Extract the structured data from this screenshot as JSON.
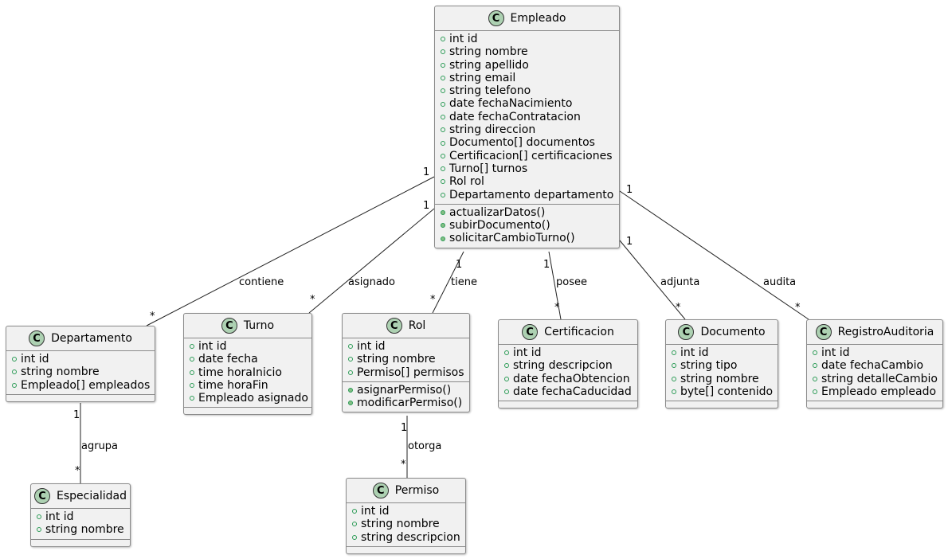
{
  "diagram": {
    "type": "UML class diagram",
    "classes": {
      "empleado": {
        "name": "Empleado",
        "stereotype_icon": "C",
        "attributes": [
          "int id",
          "string nombre",
          "string apellido",
          "string email",
          "string telefono",
          "date fechaNacimiento",
          "date fechaContratacion",
          "string direccion",
          "Documento[] documentos",
          "Certificacion[] certificaciones",
          "Turno[] turnos",
          "Rol rol",
          "Departamento departamento"
        ],
        "methods": [
          "actualizarDatos()",
          "subirDocumento()",
          "solicitarCambioTurno()"
        ]
      },
      "departamento": {
        "name": "Departamento",
        "stereotype_icon": "C",
        "attributes": [
          "int id",
          "string nombre",
          "Empleado[] empleados"
        ],
        "methods": []
      },
      "turno": {
        "name": "Turno",
        "stereotype_icon": "C",
        "attributes": [
          "int id",
          "date fecha",
          "time horaInicio",
          "time horaFin",
          "Empleado asignado"
        ],
        "methods": []
      },
      "rol": {
        "name": "Rol",
        "stereotype_icon": "C",
        "attributes": [
          "int id",
          "string nombre",
          "Permiso[] permisos"
        ],
        "methods": [
          "asignarPermiso()",
          "modificarPermiso()"
        ]
      },
      "certificacion": {
        "name": "Certificacion",
        "stereotype_icon": "C",
        "attributes": [
          "int id",
          "string descripcion",
          "date fechaObtencion",
          "date fechaCaducidad"
        ],
        "methods": []
      },
      "documento": {
        "name": "Documento",
        "stereotype_icon": "C",
        "attributes": [
          "int id",
          "string tipo",
          "string nombre",
          "byte[] contenido"
        ],
        "methods": []
      },
      "registroAuditoria": {
        "name": "RegistroAuditoria",
        "stereotype_icon": "C",
        "attributes": [
          "int id",
          "date fechaCambio",
          "string detalleCambio",
          "Empleado empleado"
        ],
        "methods": []
      },
      "especialidad": {
        "name": "Especialidad",
        "stereotype_icon": "C",
        "attributes": [
          "int id",
          "string nombre"
        ],
        "methods": []
      },
      "permiso": {
        "name": "Permiso",
        "stereotype_icon": "C",
        "attributes": [
          "int id",
          "string nombre",
          "string descripcion"
        ],
        "methods": []
      }
    },
    "relations": {
      "contiene": {
        "from": "Empleado",
        "to": "Departamento",
        "label": "contiene",
        "from_mult": "1",
        "to_mult": "*"
      },
      "asignado": {
        "from": "Empleado",
        "to": "Turno",
        "label": "asignado",
        "from_mult": "1",
        "to_mult": "*"
      },
      "tiene": {
        "from": "Empleado",
        "to": "Rol",
        "label": "tiene",
        "from_mult": "1",
        "to_mult": "*"
      },
      "posee": {
        "from": "Empleado",
        "to": "Certificacion",
        "label": "posee",
        "from_mult": "1",
        "to_mult": "*"
      },
      "adjunta": {
        "from": "Empleado",
        "to": "Documento",
        "label": "adjunta",
        "from_mult": "1",
        "to_mult": "*"
      },
      "audita": {
        "from": "Empleado",
        "to": "RegistroAuditoria",
        "label": "audita",
        "from_mult": "1",
        "to_mult": "*"
      },
      "agrupa": {
        "from": "Departamento",
        "to": "Especialidad",
        "label": "agrupa",
        "from_mult": "1",
        "to_mult": "*"
      },
      "otorga": {
        "from": "Rol",
        "to": "Permiso",
        "label": "otorga",
        "from_mult": "1",
        "to_mult": "*"
      }
    },
    "colors": {
      "class_fill": "#f1f1f1",
      "class_border": "#8a8a8a",
      "class_icon_fill": "#add1b2",
      "visibility_public": "#2b9b55"
    }
  }
}
